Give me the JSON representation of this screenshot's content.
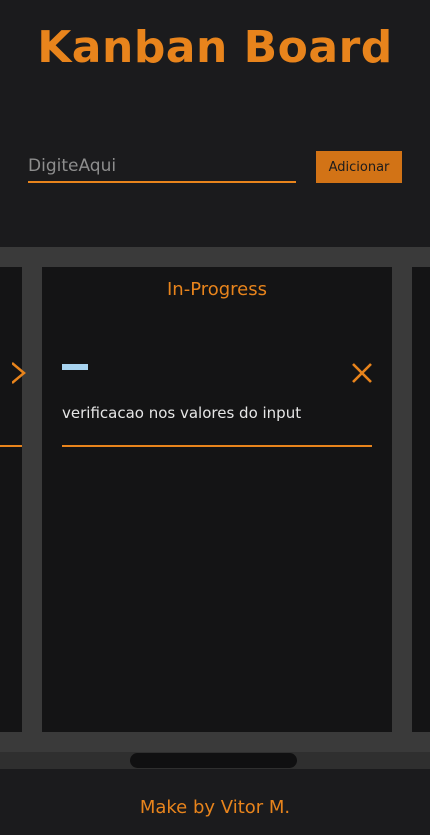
{
  "header": {
    "title": "Kanban Board"
  },
  "new_task": {
    "placeholder": "DigiteAqui",
    "add_label": "Adicionar"
  },
  "board": {
    "columns": [
      {
        "title": "In-Progress",
        "tasks": [
          {
            "text": "verificacao nos valores do input"
          }
        ]
      }
    ]
  },
  "footer": {
    "credit": "Make by Vitor M."
  },
  "colors": {
    "accent": "#e8841c",
    "background": "#1b1b1d",
    "column": "#141415",
    "board": "#3a3a3a"
  }
}
